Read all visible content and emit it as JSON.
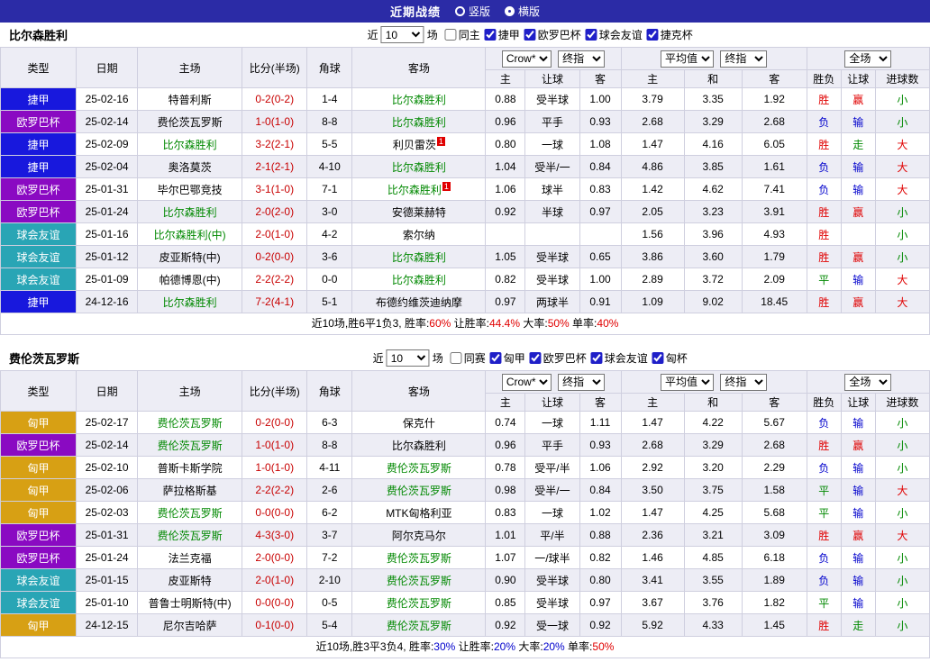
{
  "titlebar": {
    "title": "近期战绩",
    "radios": [
      {
        "label": "竖版",
        "checked": false
      },
      {
        "label": "横版",
        "checked": true
      }
    ]
  },
  "labels": {
    "near": "近",
    "games": "场"
  },
  "table_headers": {
    "type": "类型",
    "date": "日期",
    "home": "主场",
    "score": "比分(半场)",
    "corner": "角球",
    "away": "客场",
    "odds_select": "Crow*",
    "final_select": "终指",
    "avg_select": "平均值",
    "full_select": "全场",
    "odds_cols": [
      "主",
      "让球",
      "客"
    ],
    "avg_cols": [
      "主",
      "和",
      "客"
    ],
    "result_cols": [
      "胜负",
      "让球",
      "进球数"
    ]
  },
  "league_colors": {
    "捷甲": "#1818dd",
    "欧罗巴杯": "#8a0ac2",
    "球会友谊": "#29a5b5",
    "匈甲": "#d7a014"
  },
  "result_colors": {
    "r": "#e00000",
    "g": "#008800",
    "b": "#0000cc",
    "k": "#000000"
  },
  "sections": [
    {
      "team": "比尔森胜利",
      "filter": {
        "count": "10",
        "checkboxes": [
          {
            "label": "同主",
            "checked": false
          },
          {
            "label": "捷甲",
            "checked": true
          },
          {
            "label": "欧罗巴杯",
            "checked": true
          },
          {
            "label": "球会友谊",
            "checked": true
          },
          {
            "label": "捷克杯",
            "checked": true
          }
        ]
      },
      "rows": [
        {
          "lg": "捷甲",
          "date": "25-02-16",
          "home": "特普利斯",
          "hg": false,
          "hm": "",
          "score": "0-2(0-2)",
          "corner": "1-4",
          "away": "比尔森胜利",
          "ag": true,
          "am": "",
          "odds": [
            "0.88",
            "受半球",
            "1.00"
          ],
          "avg": [
            "3.79",
            "3.35",
            "1.92"
          ],
          "res": [
            [
              "胜",
              "r"
            ],
            [
              "赢",
              "r"
            ],
            [
              "小",
              "g"
            ]
          ]
        },
        {
          "lg": "欧罗巴杯",
          "date": "25-02-14",
          "home": "费伦茨瓦罗斯",
          "hg": false,
          "hm": "",
          "score": "1-0(1-0)",
          "corner": "8-8",
          "away": "比尔森胜利",
          "ag": true,
          "am": "",
          "odds": [
            "0.96",
            "平手",
            "0.93"
          ],
          "avg": [
            "2.68",
            "3.29",
            "2.68"
          ],
          "res": [
            [
              "负",
              "b"
            ],
            [
              "输",
              "b"
            ],
            [
              "小",
              "g"
            ]
          ]
        },
        {
          "lg": "捷甲",
          "date": "25-02-09",
          "home": "比尔森胜利",
          "hg": true,
          "hm": "",
          "score": "3-2(2-1)",
          "corner": "5-5",
          "away": "利贝雷茨",
          "ag": false,
          "am": "1",
          "odds": [
            "0.80",
            "一球",
            "1.08"
          ],
          "avg": [
            "1.47",
            "4.16",
            "6.05"
          ],
          "res": [
            [
              "胜",
              "r"
            ],
            [
              "走",
              "g"
            ],
            [
              "大",
              "r"
            ]
          ]
        },
        {
          "lg": "捷甲",
          "date": "25-02-04",
          "home": "奥洛莫茨",
          "hg": false,
          "hm": "",
          "score": "2-1(2-1)",
          "corner": "4-10",
          "away": "比尔森胜利",
          "ag": true,
          "am": "",
          "odds": [
            "1.04",
            "受半/一",
            "0.84"
          ],
          "avg": [
            "4.86",
            "3.85",
            "1.61"
          ],
          "res": [
            [
              "负",
              "b"
            ],
            [
              "输",
              "b"
            ],
            [
              "大",
              "r"
            ]
          ]
        },
        {
          "lg": "欧罗巴杯",
          "date": "25-01-31",
          "home": "毕尔巴鄂竞技",
          "hg": false,
          "hm": "",
          "score": "3-1(1-0)",
          "corner": "7-1",
          "away": "比尔森胜利",
          "ag": true,
          "am": "1",
          "odds": [
            "1.06",
            "球半",
            "0.83"
          ],
          "avg": [
            "1.42",
            "4.62",
            "7.41"
          ],
          "res": [
            [
              "负",
              "b"
            ],
            [
              "输",
              "b"
            ],
            [
              "大",
              "r"
            ]
          ]
        },
        {
          "lg": "欧罗巴杯",
          "date": "25-01-24",
          "home": "比尔森胜利",
          "hg": true,
          "hm": "",
          "score": "2-0(2-0)",
          "corner": "3-0",
          "away": "安德莱赫特",
          "ag": false,
          "am": "",
          "odds": [
            "0.92",
            "半球",
            "0.97"
          ],
          "avg": [
            "2.05",
            "3.23",
            "3.91"
          ],
          "res": [
            [
              "胜",
              "r"
            ],
            [
              "赢",
              "r"
            ],
            [
              "小",
              "g"
            ]
          ]
        },
        {
          "lg": "球会友谊",
          "date": "25-01-16",
          "home": "比尔森胜利(中)",
          "hg": true,
          "hm": "",
          "score": "2-0(1-0)",
          "corner": "4-2",
          "away": "索尔纳",
          "ag": false,
          "am": "",
          "odds": [
            "",
            "",
            ""
          ],
          "avg": [
            "1.56",
            "3.96",
            "4.93"
          ],
          "res": [
            [
              "胜",
              "r"
            ],
            [
              "",
              ""
            ],
            [
              "小",
              "g"
            ]
          ]
        },
        {
          "lg": "球会友谊",
          "date": "25-01-12",
          "home": "皮亚斯特(中)",
          "hg": false,
          "hm": "",
          "score": "0-2(0-0)",
          "corner": "3-6",
          "away": "比尔森胜利",
          "ag": true,
          "am": "",
          "odds": [
            "1.05",
            "受半球",
            "0.65"
          ],
          "avg": [
            "3.86",
            "3.60",
            "1.79"
          ],
          "res": [
            [
              "胜",
              "r"
            ],
            [
              "赢",
              "r"
            ],
            [
              "小",
              "g"
            ]
          ]
        },
        {
          "lg": "球会友谊",
          "date": "25-01-09",
          "home": "帕德博恩(中)",
          "hg": false,
          "hm": "",
          "score": "2-2(2-2)",
          "corner": "0-0",
          "away": "比尔森胜利",
          "ag": true,
          "am": "",
          "odds": [
            "0.82",
            "受半球",
            "1.00"
          ],
          "avg": [
            "2.89",
            "3.72",
            "2.09"
          ],
          "res": [
            [
              "平",
              "g"
            ],
            [
              "输",
              "b"
            ],
            [
              "大",
              "r"
            ]
          ]
        },
        {
          "lg": "捷甲",
          "date": "24-12-16",
          "home": "比尔森胜利",
          "hg": true,
          "hm": "",
          "score": "7-2(4-1)",
          "corner": "5-1",
          "away": "布德约维茨迪纳摩",
          "ag": false,
          "am": "",
          "odds": [
            "0.97",
            "两球半",
            "0.91"
          ],
          "avg": [
            "1.09",
            "9.02",
            "18.45"
          ],
          "res": [
            [
              "胜",
              "r"
            ],
            [
              "赢",
              "r"
            ],
            [
              "大",
              "r"
            ]
          ]
        }
      ],
      "summary": [
        {
          "t": "近10场,胜6平1负3, ",
          "c": "k"
        },
        {
          "t": "胜率:",
          "c": "k"
        },
        {
          "t": "60%",
          "c": "r"
        },
        {
          "t": " 让胜率:",
          "c": "k"
        },
        {
          "t": "44.4%",
          "c": "r"
        },
        {
          "t": " 大率:",
          "c": "k"
        },
        {
          "t": "50%",
          "c": "r"
        },
        {
          "t": " 单率:",
          "c": "k"
        },
        {
          "t": "40%",
          "c": "r"
        }
      ]
    },
    {
      "team": "费伦茨瓦罗斯",
      "filter": {
        "count": "10",
        "checkboxes": [
          {
            "label": "同赛",
            "checked": false
          },
          {
            "label": "匈甲",
            "checked": true
          },
          {
            "label": "欧罗巴杯",
            "checked": true
          },
          {
            "label": "球会友谊",
            "checked": true
          },
          {
            "label": "匈杯",
            "checked": true
          }
        ]
      },
      "rows": [
        {
          "lg": "匈甲",
          "date": "25-02-17",
          "home": "费伦茨瓦罗斯",
          "hg": true,
          "hm": "",
          "score": "0-2(0-0)",
          "corner": "6-3",
          "away": "保克什",
          "ag": false,
          "am": "",
          "odds": [
            "0.74",
            "一球",
            "1.11"
          ],
          "avg": [
            "1.47",
            "4.22",
            "5.67"
          ],
          "res": [
            [
              "负",
              "b"
            ],
            [
              "输",
              "b"
            ],
            [
              "小",
              "g"
            ]
          ]
        },
        {
          "lg": "欧罗巴杯",
          "date": "25-02-14",
          "home": "费伦茨瓦罗斯",
          "hg": true,
          "hm": "",
          "score": "1-0(1-0)",
          "corner": "8-8",
          "away": "比尔森胜利",
          "ag": false,
          "am": "",
          "odds": [
            "0.96",
            "平手",
            "0.93"
          ],
          "avg": [
            "2.68",
            "3.29",
            "2.68"
          ],
          "res": [
            [
              "胜",
              "r"
            ],
            [
              "赢",
              "r"
            ],
            [
              "小",
              "g"
            ]
          ]
        },
        {
          "lg": "匈甲",
          "date": "25-02-10",
          "home": "普斯卡斯学院",
          "hg": false,
          "hm": "",
          "score": "1-0(1-0)",
          "corner": "4-11",
          "away": "费伦茨瓦罗斯",
          "ag": true,
          "am": "",
          "odds": [
            "0.78",
            "受平/半",
            "1.06"
          ],
          "avg": [
            "2.92",
            "3.20",
            "2.29"
          ],
          "res": [
            [
              "负",
              "b"
            ],
            [
              "输",
              "b"
            ],
            [
              "小",
              "g"
            ]
          ]
        },
        {
          "lg": "匈甲",
          "date": "25-02-06",
          "home": "萨拉格斯基",
          "hg": false,
          "hm": "",
          "score": "2-2(2-2)",
          "corner": "2-6",
          "away": "费伦茨瓦罗斯",
          "ag": true,
          "am": "",
          "odds": [
            "0.98",
            "受半/一",
            "0.84"
          ],
          "avg": [
            "3.50",
            "3.75",
            "1.58"
          ],
          "res": [
            [
              "平",
              "g"
            ],
            [
              "输",
              "b"
            ],
            [
              "大",
              "r"
            ]
          ]
        },
        {
          "lg": "匈甲",
          "date": "25-02-03",
          "home": "费伦茨瓦罗斯",
          "hg": true,
          "hm": "",
          "score": "0-0(0-0)",
          "corner": "6-2",
          "away": "MTK匈格利亚",
          "ag": false,
          "am": "",
          "odds": [
            "0.83",
            "一球",
            "1.02"
          ],
          "avg": [
            "1.47",
            "4.25",
            "5.68"
          ],
          "res": [
            [
              "平",
              "g"
            ],
            [
              "输",
              "b"
            ],
            [
              "小",
              "g"
            ]
          ]
        },
        {
          "lg": "欧罗巴杯",
          "date": "25-01-31",
          "home": "费伦茨瓦罗斯",
          "hg": true,
          "hm": "",
          "score": "4-3(3-0)",
          "corner": "3-7",
          "away": "阿尔克马尔",
          "ag": false,
          "am": "",
          "odds": [
            "1.01",
            "平/半",
            "0.88"
          ],
          "avg": [
            "2.36",
            "3.21",
            "3.09"
          ],
          "res": [
            [
              "胜",
              "r"
            ],
            [
              "赢",
              "r"
            ],
            [
              "大",
              "r"
            ]
          ]
        },
        {
          "lg": "欧罗巴杯",
          "date": "25-01-24",
          "home": "法兰克福",
          "hg": false,
          "hm": "",
          "score": "2-0(0-0)",
          "corner": "7-2",
          "away": "费伦茨瓦罗斯",
          "ag": true,
          "am": "",
          "odds": [
            "1.07",
            "一/球半",
            "0.82"
          ],
          "avg": [
            "1.46",
            "4.85",
            "6.18"
          ],
          "res": [
            [
              "负",
              "b"
            ],
            [
              "输",
              "b"
            ],
            [
              "小",
              "g"
            ]
          ]
        },
        {
          "lg": "球会友谊",
          "date": "25-01-15",
          "home": "皮亚斯特",
          "hg": false,
          "hm": "",
          "score": "2-0(1-0)",
          "corner": "2-10",
          "away": "费伦茨瓦罗斯",
          "ag": true,
          "am": "",
          "odds": [
            "0.90",
            "受半球",
            "0.80"
          ],
          "avg": [
            "3.41",
            "3.55",
            "1.89"
          ],
          "res": [
            [
              "负",
              "b"
            ],
            [
              "输",
              "b"
            ],
            [
              "小",
              "g"
            ]
          ]
        },
        {
          "lg": "球会友谊",
          "date": "25-01-10",
          "home": "普鲁士明斯特(中)",
          "hg": false,
          "hm": "",
          "score": "0-0(0-0)",
          "corner": "0-5",
          "away": "费伦茨瓦罗斯",
          "ag": true,
          "am": "",
          "odds": [
            "0.85",
            "受半球",
            "0.97"
          ],
          "avg": [
            "3.67",
            "3.76",
            "1.82"
          ],
          "res": [
            [
              "平",
              "g"
            ],
            [
              "输",
              "b"
            ],
            [
              "小",
              "g"
            ]
          ]
        },
        {
          "lg": "匈甲",
          "date": "24-12-15",
          "home": "尼尔吉哈萨",
          "hg": false,
          "hm": "",
          "score": "0-1(0-0)",
          "corner": "5-4",
          "away": "费伦茨瓦罗斯",
          "ag": true,
          "am": "",
          "odds": [
            "0.92",
            "受一球",
            "0.92"
          ],
          "avg": [
            "5.92",
            "4.33",
            "1.45"
          ],
          "res": [
            [
              "胜",
              "r"
            ],
            [
              "走",
              "g"
            ],
            [
              "小",
              "g"
            ]
          ]
        }
      ],
      "summary": [
        {
          "t": "近10场,胜3平3负4, ",
          "c": "k"
        },
        {
          "t": "胜率:",
          "c": "k"
        },
        {
          "t": "30%",
          "c": "b"
        },
        {
          "t": " 让胜率:",
          "c": "k"
        },
        {
          "t": "20%",
          "c": "b"
        },
        {
          "t": " 大率:",
          "c": "k"
        },
        {
          "t": "20%",
          "c": "b"
        },
        {
          "t": " 单率:",
          "c": "k"
        },
        {
          "t": "50%",
          "c": "r"
        }
      ]
    }
  ]
}
